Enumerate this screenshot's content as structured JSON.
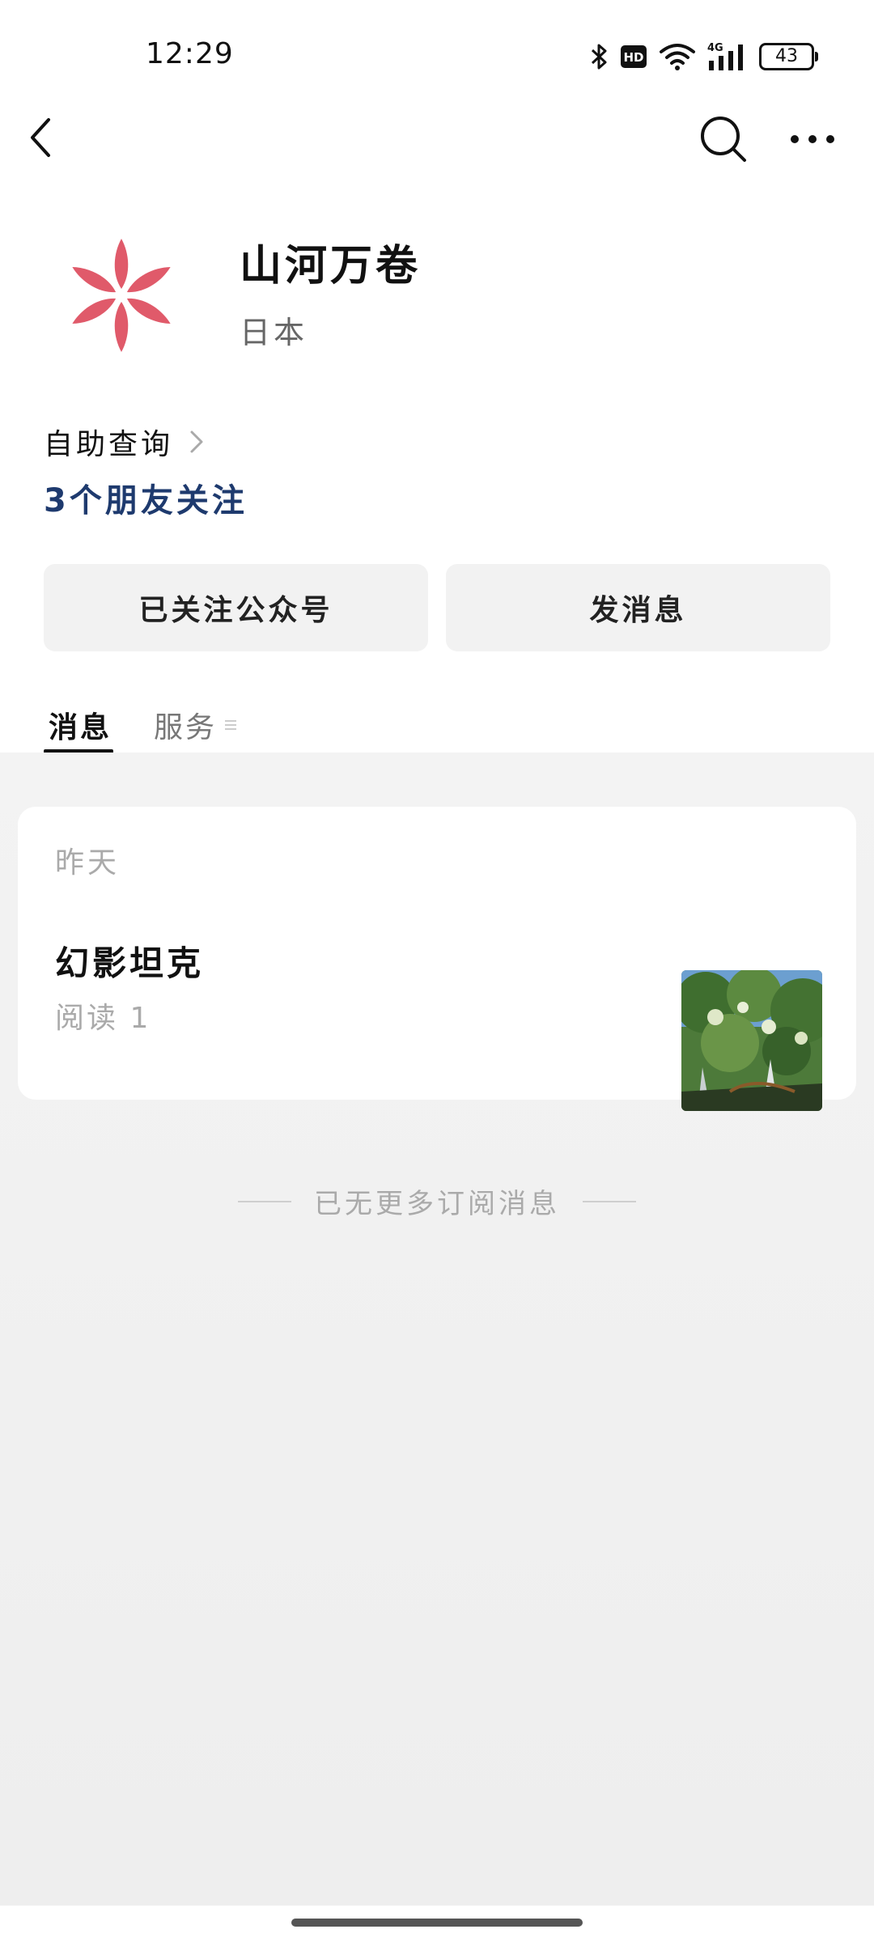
{
  "status_bar": {
    "time": "12:29",
    "network_label": "4G",
    "hd_label": "HD",
    "battery": "43",
    "icons": [
      "bluetooth-icon",
      "hd-icon",
      "wifi-icon",
      "signal-icon",
      "battery-icon"
    ]
  },
  "nav": {
    "back_icon": "chevron-left-icon",
    "search_icon": "search-icon",
    "more_icon": "more-icon"
  },
  "profile": {
    "name": "山河万卷",
    "region": "日本",
    "logo_icon": "flower-logo-icon",
    "logo_color": "#e05a6a"
  },
  "self_service": {
    "label": "自助查询"
  },
  "friends_follow": "3个朋友关注",
  "buttons": {
    "follow_label": "已关注公众号",
    "message_label": "发消息"
  },
  "tabs": {
    "messages": "消息",
    "services": "服务"
  },
  "feed": {
    "date_label": "昨天",
    "article": {
      "title": "幻影坦克",
      "reads": "阅读 1"
    },
    "end_note": "已无更多订阅消息"
  },
  "colors": {
    "link": "#1e3a6e",
    "muted": "#aaaaaa",
    "button_bg": "#f2f2f2"
  }
}
